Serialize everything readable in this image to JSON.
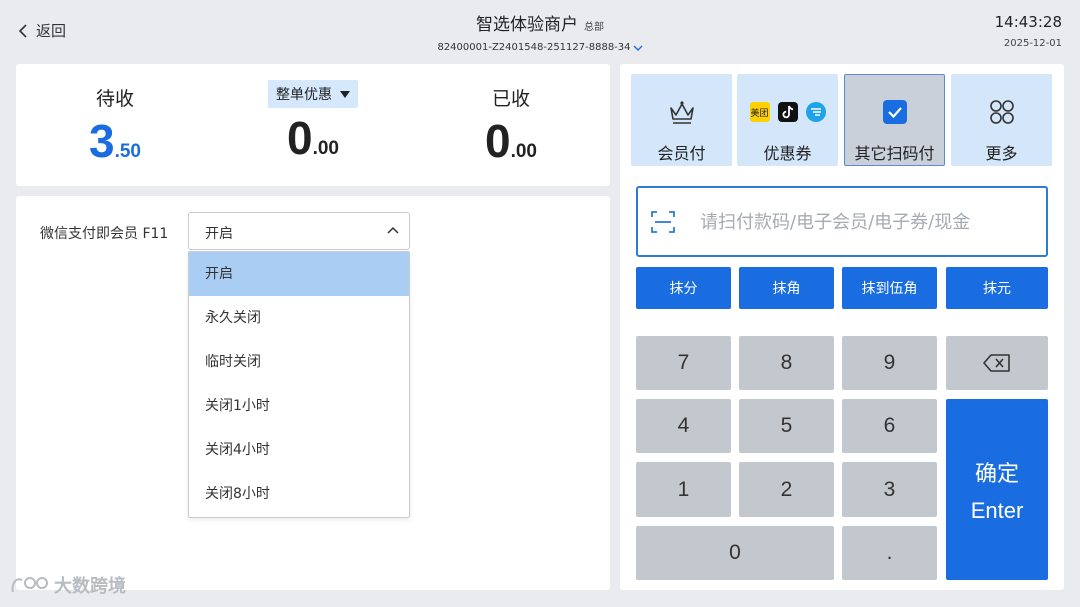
{
  "header": {
    "back_label": "返回",
    "merchant_name": "智选体验商户",
    "merchant_tag": "总部",
    "merchant_code": "82400001-Z2401548-251127-8888-34",
    "time": "14:43:28",
    "date": "2025-12-01"
  },
  "summary": {
    "pending_label": "待收",
    "pending_int": "3",
    "pending_dec": ".50",
    "discount_label": "整单优惠",
    "discount_int": "0",
    "discount_dec": ".00",
    "received_label": "已收",
    "received_int": "0",
    "received_dec": ".00"
  },
  "settings": {
    "wx_member_label": "微信支付即会员 F11",
    "selected_value": "开启",
    "options": [
      "开启",
      "永久关闭",
      "临时关闭",
      "关闭1小时",
      "关闭4小时",
      "关闭8小时"
    ]
  },
  "watermark": "大数跨境",
  "payment": {
    "methods": [
      {
        "label": "会员付",
        "icon": "crown-icon"
      },
      {
        "label": "优惠券",
        "icon": "coupon-platforms-icon",
        "brand": "美团"
      },
      {
        "label": "其它扫码付",
        "icon": "checkbox-icon"
      },
      {
        "label": "更多",
        "icon": "grid-icon"
      }
    ],
    "scan_placeholder": "请扫付款码/电子会员/电子券/现金",
    "rounding": [
      "抹分",
      "抹角",
      "抹到伍角",
      "抹元"
    ],
    "keys": [
      "7",
      "8",
      "9",
      "4",
      "5",
      "6",
      "1",
      "2",
      "3",
      "0",
      "."
    ],
    "enter_cn": "确定",
    "enter_en": "Enter",
    "colors": {
      "accent": "#1a6de0",
      "light": "#d3e6fa",
      "key": "#c3c7ce"
    }
  }
}
